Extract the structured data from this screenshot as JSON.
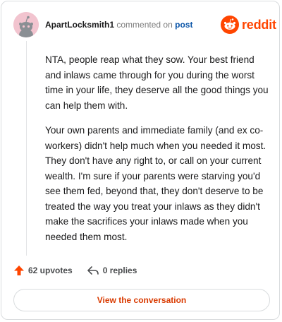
{
  "comment": {
    "username": "ApartLocksmith1",
    "action_text": "commented on",
    "post_link": "post",
    "paragraphs": [
      "NTA, people reap what they sow. Your best friend and inlaws came through for you during the worst time in your life, they deserve all the good things you can help them with.",
      "Your own parents and immediate family (and ex co-workers) didn't help much when you needed it most. They don't have any right to, or call on your current wealth. I'm sure if your parents were starving you'd see them fed, beyond that, they don't deserve to be treated the way you treat your inlaws as they didn't make the sacrifices your inlaws made when you needed them most."
    ],
    "upvotes": "62 upvotes",
    "replies": "0 replies"
  },
  "brand": {
    "wordmark": "reddit",
    "accent": "#ff4500"
  },
  "cta": {
    "label": "View the conversation"
  },
  "icons": {
    "avatar": "snoo-avatar",
    "logo": "reddit-snoo-icon",
    "upvote": "upvote-arrow-icon",
    "reply": "reply-arrow-icon"
  }
}
